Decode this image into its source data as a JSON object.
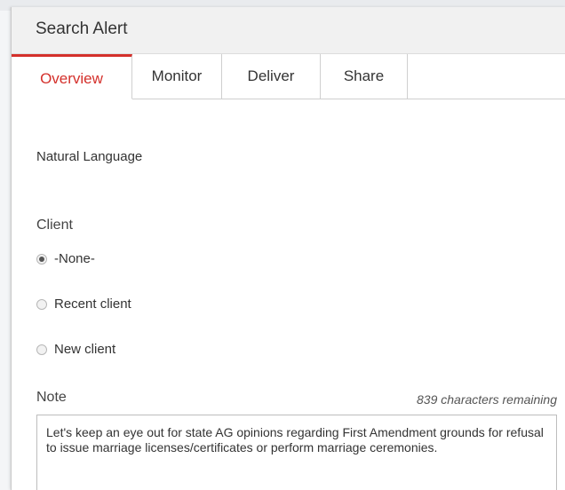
{
  "dialog": {
    "title": "Search Alert"
  },
  "tabs": [
    {
      "label": "Overview",
      "active": true
    },
    {
      "label": "Monitor",
      "active": false
    },
    {
      "label": "Deliver",
      "active": false
    },
    {
      "label": "Share",
      "active": false
    }
  ],
  "overview": {
    "search_type": "Natural Language",
    "client": {
      "label": "Client",
      "options": [
        {
          "label": "-None-",
          "selected": true
        },
        {
          "label": "Recent client",
          "selected": false
        },
        {
          "label": "New client",
          "selected": false
        }
      ]
    },
    "note": {
      "label": "Note",
      "remaining": "839 characters remaining",
      "value": "Let's keep an eye out for state AG opinions regarding First Amendment grounds for refusal to issue marriage licenses/certificates or perform marriage ceremonies."
    }
  },
  "colors": {
    "accent": "#d4302b",
    "header_bg": "#f1f1f1"
  }
}
